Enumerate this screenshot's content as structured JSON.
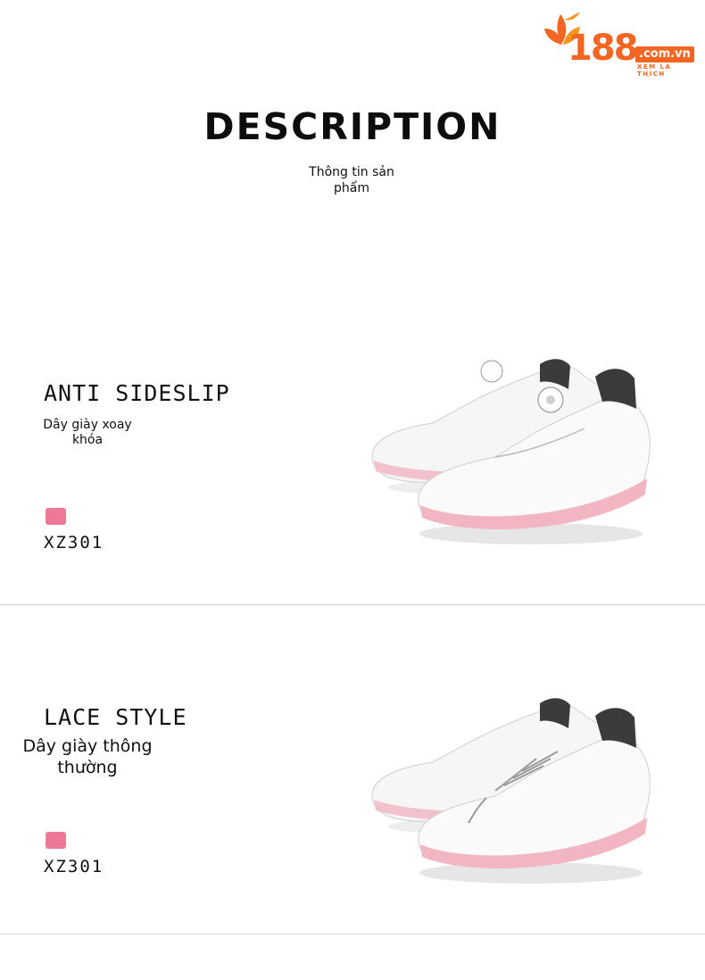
{
  "brand": {
    "number": "188",
    "domain": ".com.vn",
    "tagline": "XEM LÀ THÍCH",
    "accent_color": "#f26522"
  },
  "header": {
    "title": "DESCRIPTION",
    "subtitle": "Thông tin sản phẩm"
  },
  "features": [
    {
      "title": "ANTI SIDESLIP",
      "description": "Dây giày xoay khóa",
      "color_swatch": "#ee7896",
      "code": "XZ301",
      "image": "white-pink-golf-shoes-boa-dial"
    },
    {
      "title": "LACE STYLE",
      "description": "Dây giày thông thường",
      "color_swatch": "#ee7896",
      "code": "XZ301",
      "image": "white-pink-golf-shoes-laced"
    }
  ]
}
